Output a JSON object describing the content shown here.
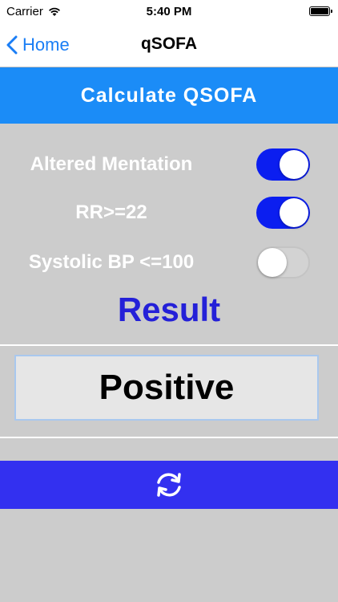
{
  "status_bar": {
    "carrier": "Carrier",
    "time": "5:40 PM"
  },
  "nav": {
    "back_label": "Home",
    "title": "qSOFA"
  },
  "header": {
    "title": "Calculate  QSOFA"
  },
  "criteria": [
    {
      "label": "Altered Mentation",
      "enabled": true
    },
    {
      "label": "RR>=22",
      "enabled": true
    },
    {
      "label": "Systolic BP <=100",
      "enabled": false
    }
  ],
  "result": {
    "title": "Result",
    "value": "Positive"
  },
  "colors": {
    "accent_blue": "#1b8cf7",
    "toggle_on": "#0b1ef0",
    "result_title": "#2420d8",
    "refresh_bar": "#3330f0",
    "background": "#cccccc"
  },
  "icons": {
    "refresh": "refresh-icon",
    "back": "chevron-left-icon",
    "wifi": "wifi-icon",
    "battery": "battery-icon"
  }
}
